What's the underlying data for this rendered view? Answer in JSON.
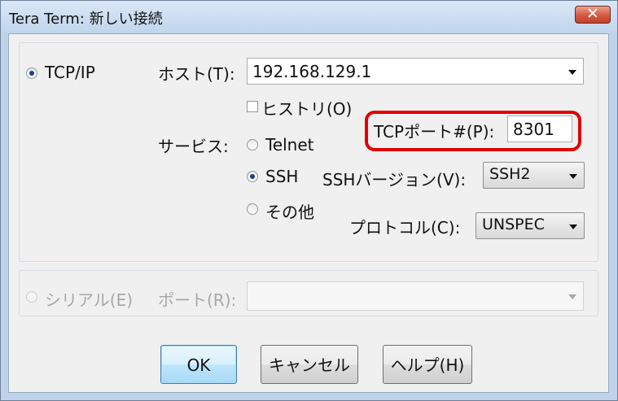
{
  "window": {
    "title": "Tera Term: 新しい接続",
    "close_glyph": "✕"
  },
  "tcpip": {
    "radio_label": "TCP/IP",
    "host_label": "ホスト(T):",
    "host_value": "192.168.129.1",
    "history_label": "ヒストリ(O)",
    "history_checked": false,
    "service_label": "サービス:",
    "telnet_label": "Telnet",
    "ssh_label": "SSH",
    "other_label": "その他",
    "selected_service": "SSH",
    "tcp_port_label": "TCPポート#(P):",
    "tcp_port_value": "8301",
    "ssh_version_label": "SSHバージョン(V):",
    "ssh_version_value": "SSH2",
    "protocol_label": "プロトコル(C):",
    "protocol_value": "UNSPEC"
  },
  "serial": {
    "radio_label": "シリアル(E)",
    "port_label": "ポート(R):",
    "port_value": ""
  },
  "buttons": {
    "ok": "OK",
    "cancel": "キャンセル",
    "help": "ヘルプ(H)"
  },
  "colors": {
    "highlight": "#e00000",
    "title_bg": "#c4d7ee",
    "close_bg": "#d4583f"
  }
}
